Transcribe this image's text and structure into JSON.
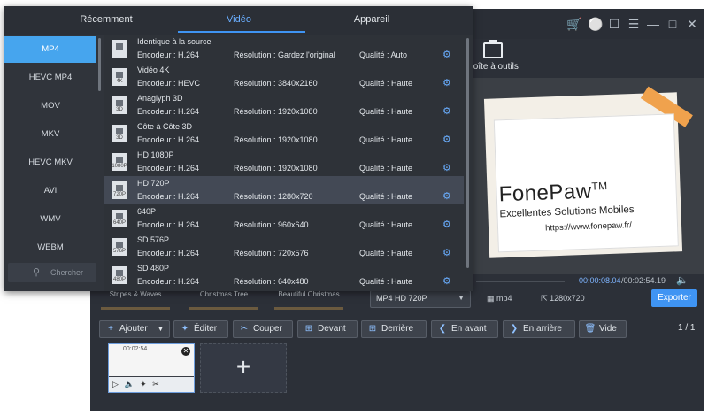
{
  "window": {
    "toolbox_label": "Boîte à outils",
    "titlebar_icons": [
      "cart-icon",
      "bulb-icon",
      "chat-icon",
      "menu-icon",
      "minimize-icon",
      "maximize-icon",
      "close-icon"
    ]
  },
  "preview": {
    "logo_text": "FonePaw",
    "logo_tm": "TM",
    "slogan": "Excellentes Solutions Mobiles",
    "url": "https://www.fonepaw.fr/",
    "time_current": "00:00:08.04",
    "time_total": "/00:02:54.19"
  },
  "templates": [
    "Stripes & Waves",
    "Christmas Tree",
    "Beautiful Christmas"
  ],
  "output": {
    "format_selected": "MP4 HD 720P",
    "container": "mp4",
    "resolution": "1280x720",
    "export_label": "Exporter"
  },
  "actions": {
    "add": "Ajouter",
    "edit": "Éditer",
    "cut": "Couper",
    "forward": "Devant",
    "backward": "Derrière",
    "move_ahead": "En avant",
    "move_back": "En arrière",
    "empty": "Vide",
    "page": "1 / 1"
  },
  "clip": {
    "duration": "00:02:54"
  },
  "dropdown": {
    "tabs": [
      "Récemment",
      "Vidéo",
      "Appareil"
    ],
    "active_tab": "Vidéo",
    "formats": [
      "MP4",
      "HEVC MP4",
      "MOV",
      "MKV",
      "HEVC MKV",
      "AVI",
      "WMV",
      "WEBM"
    ],
    "selected_format": "MP4",
    "search_placeholder": "Chercher",
    "presets": [
      {
        "name": "Identique à la source",
        "encoder": "Encodeur : H.264",
        "resolution": "Résolution : Gardez l'original",
        "quality": "Qualité : Auto",
        "badge": ""
      },
      {
        "name": "Vidéo 4K",
        "encoder": "Encodeur : HEVC",
        "resolution": "Résolution : 3840x2160",
        "quality": "Qualité : Haute",
        "badge": "4K"
      },
      {
        "name": "Anaglyph 3D",
        "encoder": "Encodeur : H.264",
        "resolution": "Résolution : 1920x1080",
        "quality": "Qualité : Haute",
        "badge": "3D"
      },
      {
        "name": "Côte à Côte 3D",
        "encoder": "Encodeur : H.264",
        "resolution": "Résolution : 1920x1080",
        "quality": "Qualité : Haute",
        "badge": "3D"
      },
      {
        "name": "HD 1080P",
        "encoder": "Encodeur : H.264",
        "resolution": "Résolution : 1920x1080",
        "quality": "Qualité : Haute",
        "badge": "1080P"
      },
      {
        "name": "HD 720P",
        "encoder": "Encodeur : H.264",
        "resolution": "Résolution : 1280x720",
        "quality": "Qualité : Haute",
        "badge": "720P"
      },
      {
        "name": "640P",
        "encoder": "Encodeur : H.264",
        "resolution": "Résolution : 960x640",
        "quality": "Qualité : Haute",
        "badge": "640P"
      },
      {
        "name": "SD 576P",
        "encoder": "Encodeur : H.264",
        "resolution": "Résolution : 720x576",
        "quality": "Qualité : Haute",
        "badge": "576P"
      },
      {
        "name": "SD 480P",
        "encoder": "Encodeur : H.264",
        "resolution": "Résolution : 640x480",
        "quality": "Qualité : Haute",
        "badge": "480P"
      }
    ],
    "selected_preset": "HD 720P"
  }
}
